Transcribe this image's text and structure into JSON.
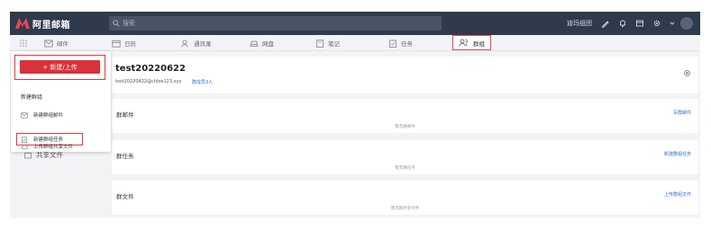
{
  "app": {
    "logo_text": "阿里邮箱",
    "search_placeholder": "搜索",
    "user_name": "迪玛组团",
    "icons": [
      "pen-icon",
      "bell-icon",
      "window-icon",
      "gear-icon",
      "chevron-down-icon"
    ]
  },
  "nav": {
    "items": [
      {
        "label": "邮件",
        "icon": "mail-icon"
      },
      {
        "label": "日历",
        "icon": "calendar-icon"
      },
      {
        "label": "通讯录",
        "icon": "contacts-icon"
      },
      {
        "label": "网盘",
        "icon": "cloud-icon"
      },
      {
        "label": "笔记",
        "icon": "note-icon"
      },
      {
        "label": "任务",
        "icon": "task-icon"
      },
      {
        "label": "群组",
        "icon": "group-icon",
        "active": true
      }
    ]
  },
  "dropdown": {
    "new_button": "+ 新建/上传",
    "new_group": "新建群组",
    "items": [
      {
        "label": "新建群组邮件",
        "icon": "mail-icon"
      },
      {
        "label": "新建群组任务",
        "icon": "task-icon"
      },
      {
        "label": "上传群组共享文件",
        "icon": "cloud-icon"
      }
    ]
  },
  "sidebar": {
    "shared_files": "共享文件"
  },
  "group": {
    "name": "test20220622",
    "email": "test20220422@chloe123.xyz",
    "invite": "群成员3人"
  },
  "panels": [
    {
      "title": "群邮件",
      "action": "写群邮件",
      "empty": "暂无群邮件"
    },
    {
      "title": "群任务",
      "action": "新建群组任务",
      "empty": "暂无群任务"
    },
    {
      "title": "群文件",
      "action": "上传群组文件",
      "empty": "暂无群共享文件"
    }
  ],
  "colors": {
    "topbar": "#2f3a4d",
    "accent": "#d8323a",
    "link": "#2f6bd8"
  }
}
